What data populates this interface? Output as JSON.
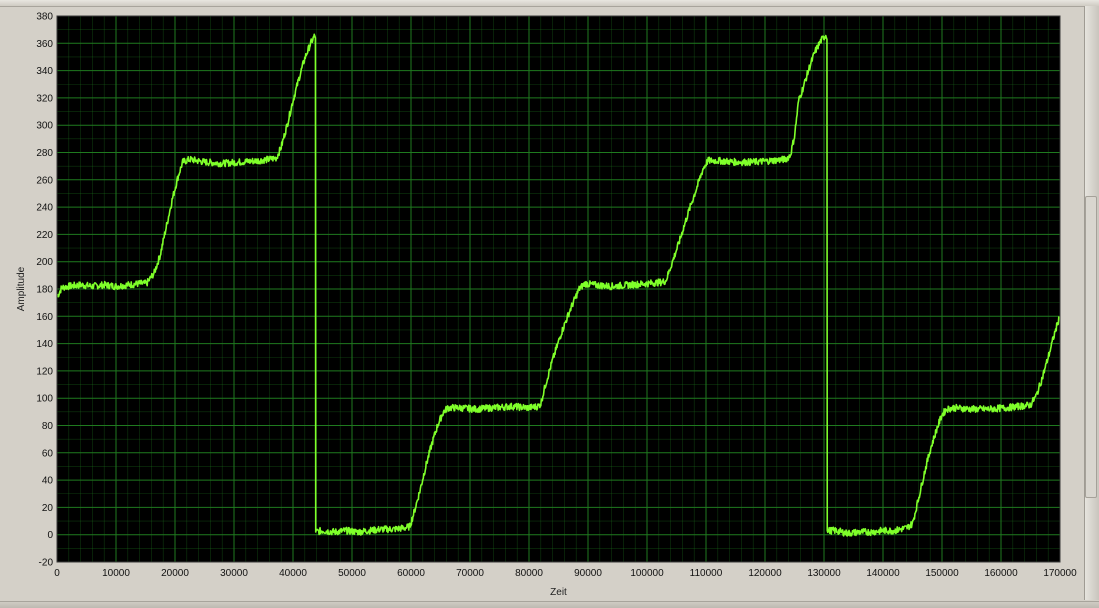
{
  "chart_data": {
    "type": "line",
    "xlabel": "Zeit",
    "ylabel": "Amplitude",
    "xlim": [
      0,
      170000
    ],
    "ylim": [
      -20,
      380
    ],
    "xticks": [
      0,
      10000,
      20000,
      30000,
      40000,
      50000,
      60000,
      70000,
      80000,
      90000,
      100000,
      110000,
      120000,
      130000,
      140000,
      150000,
      160000,
      170000
    ],
    "yticks": [
      -20,
      0,
      20,
      40,
      60,
      80,
      100,
      120,
      140,
      160,
      180,
      200,
      220,
      240,
      260,
      280,
      300,
      320,
      340,
      360,
      380
    ],
    "grid": true,
    "background_color": "#000000",
    "grid_color": "#1f7a1f",
    "line_color": "#7fff2a",
    "series": [
      {
        "points": [
          [
            0,
            174
          ],
          [
            800,
            181
          ],
          [
            2000,
            182
          ],
          [
            4000,
            183
          ],
          [
            6000,
            182
          ],
          [
            8000,
            183
          ],
          [
            10000,
            182
          ],
          [
            12000,
            183
          ],
          [
            14000,
            184
          ],
          [
            15200,
            184
          ],
          [
            16500,
            192
          ],
          [
            17500,
            205
          ],
          [
            18500,
            225
          ],
          [
            19500,
            245
          ],
          [
            20500,
            262
          ],
          [
            21300,
            273
          ],
          [
            22500,
            275
          ],
          [
            25000,
            273
          ],
          [
            28000,
            272
          ],
          [
            31000,
            273
          ],
          [
            34000,
            274
          ],
          [
            36000,
            275
          ],
          [
            37200,
            276
          ],
          [
            38000,
            284
          ],
          [
            39000,
            300
          ],
          [
            40000,
            318
          ],
          [
            41000,
            334
          ],
          [
            42000,
            349
          ],
          [
            43000,
            360
          ],
          [
            43600,
            365
          ],
          [
            43800,
            365
          ],
          [
            43850,
            2
          ],
          [
            45000,
            3
          ],
          [
            47000,
            2
          ],
          [
            49000,
            3
          ],
          [
            51000,
            2
          ],
          [
            53000,
            3
          ],
          [
            55000,
            4
          ],
          [
            57000,
            4
          ],
          [
            59000,
            5
          ],
          [
            59800,
            6
          ],
          [
            60500,
            16
          ],
          [
            61500,
            32
          ],
          [
            62500,
            50
          ],
          [
            63500,
            66
          ],
          [
            64500,
            80
          ],
          [
            65500,
            90
          ],
          [
            66300,
            93
          ],
          [
            68000,
            93
          ],
          [
            71000,
            92
          ],
          [
            74000,
            93
          ],
          [
            77000,
            94
          ],
          [
            80000,
            93
          ],
          [
            81500,
            94
          ],
          [
            82000,
            96
          ],
          [
            82800,
            110
          ],
          [
            84000,
            128
          ],
          [
            85500,
            148
          ],
          [
            87000,
            165
          ],
          [
            88500,
            180
          ],
          [
            89500,
            184
          ],
          [
            91000,
            183
          ],
          [
            94000,
            182
          ],
          [
            97000,
            183
          ],
          [
            100000,
            184
          ],
          [
            102500,
            185
          ],
          [
            103200,
            186
          ],
          [
            104000,
            196
          ],
          [
            105500,
            215
          ],
          [
            107000,
            236
          ],
          [
            108500,
            255
          ],
          [
            109500,
            268
          ],
          [
            110300,
            274
          ],
          [
            112000,
            274
          ],
          [
            115000,
            273
          ],
          [
            118000,
            273
          ],
          [
            121000,
            274
          ],
          [
            123500,
            275
          ],
          [
            124300,
            278
          ],
          [
            125000,
            292
          ],
          [
            125700,
            318
          ],
          [
            126500,
            328
          ],
          [
            127500,
            342
          ],
          [
            128500,
            354
          ],
          [
            129500,
            362
          ],
          [
            130300,
            366
          ],
          [
            130500,
            365
          ],
          [
            130550,
            3
          ],
          [
            132000,
            3
          ],
          [
            134000,
            1
          ],
          [
            136000,
            2
          ],
          [
            138000,
            2
          ],
          [
            140000,
            3
          ],
          [
            142000,
            3
          ],
          [
            144000,
            5
          ],
          [
            145000,
            8
          ],
          [
            146000,
            26
          ],
          [
            147000,
            45
          ],
          [
            148000,
            62
          ],
          [
            149000,
            76
          ],
          [
            150000,
            88
          ],
          [
            150800,
            92
          ],
          [
            152000,
            93
          ],
          [
            155000,
            92
          ],
          [
            158000,
            92
          ],
          [
            161000,
            93
          ],
          [
            163000,
            94
          ],
          [
            165000,
            95
          ],
          [
            166000,
            102
          ],
          [
            167000,
            115
          ],
          [
            168000,
            130
          ],
          [
            169000,
            146
          ],
          [
            169800,
            158
          ]
        ]
      }
    ]
  }
}
